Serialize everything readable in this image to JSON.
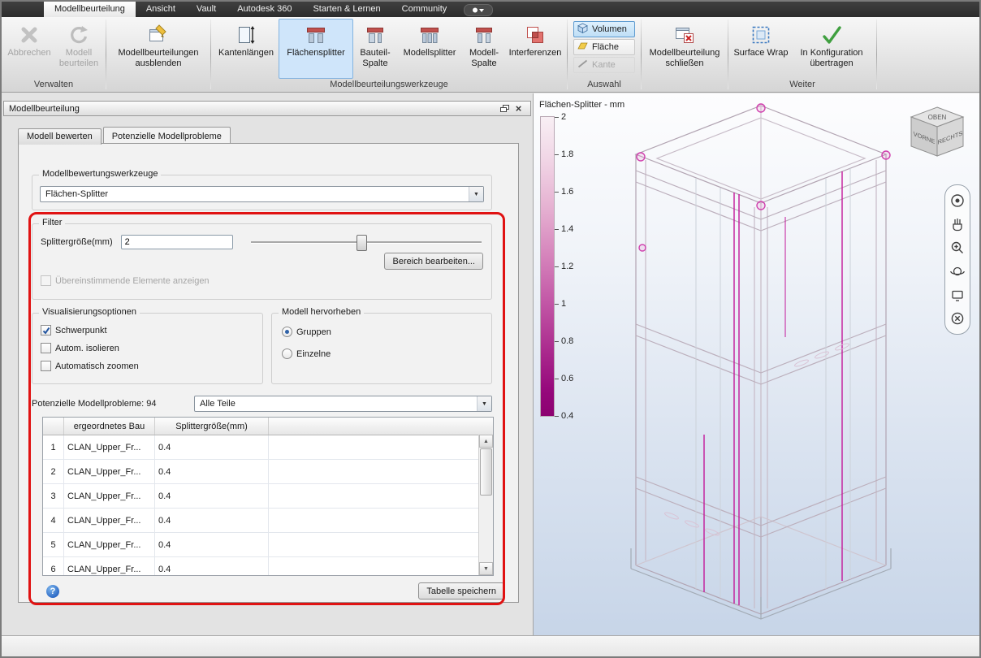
{
  "colors": {
    "selection_blue": "#cfe5fa",
    "splitter_magenta": "#c2189a",
    "annotation_red": "#e01212"
  },
  "menu": {
    "tabs": [
      "Modellbeurteilung",
      "Ansicht",
      "Vault",
      "Autodesk 360",
      "Starten & Lernen",
      "Community"
    ]
  },
  "ribbon": {
    "groups": {
      "verwalten": {
        "label": "Verwalten"
      },
      "werkzeuge": {
        "label": "Modellbeurteilungswerkzeuge"
      },
      "auswahl": {
        "label": "Auswahl"
      },
      "weiter": {
        "label": "Weiter"
      }
    },
    "buttons": {
      "abbrechen": "Abbrechen",
      "beurteilen": "Modell\nbeurteilen",
      "ausblenden": "Modellbeurteilungen\nausblenden",
      "kantenlaengen": "Kantenlängen",
      "flaechensplitter": "Flächensplitter",
      "bauteil_spalte": "Bauteil-\nSpalte",
      "modellsplitter": "Modellsplitter",
      "modell_spalte": "Modell-\nSpalte",
      "interferenzen": "Interferenzen",
      "volumen": "Volumen",
      "flaeche": "Fläche",
      "kante": "Kante",
      "schliessen": "Modellbeurteilung\nschließen",
      "surface_wrap": "Surface Wrap",
      "uebertragen": "In Konfiguration\nübertragen"
    }
  },
  "panel": {
    "title": "Modellbeurteilung",
    "tabs": [
      "Modell bewerten",
      "Potenzielle Modellprobleme"
    ],
    "tools_group": "Modellbewertungswerkzeuge",
    "tools_combo": "Flächen-Splitter",
    "filter": {
      "legend": "Filter",
      "size_label": "Splittergröße(mm)",
      "size_value": "2",
      "edit_range_button": "Bereich bearbeiten...",
      "show_matching": "Übereinstimmende Elemente anzeigen"
    },
    "visual": {
      "legend": "Visualisierungsoptionen",
      "opt1": "Schwerpunkt",
      "opt2": "Autom. isolieren",
      "opt3": "Automatisch zoomen"
    },
    "highlight": {
      "legend": "Modell hervorheben",
      "opt1": "Gruppen",
      "opt2": "Einzelne"
    },
    "problems_label": "Potenzielle Modellprobleme: 94",
    "parts_combo": "Alle Teile",
    "table": {
      "col_part": "ergeordnetes Bau",
      "col_size": "Splittergröße(mm)",
      "rows": [
        {
          "num": "1",
          "part": "CLAN_Upper_Fr...",
          "size": "0.4"
        },
        {
          "num": "2",
          "part": "CLAN_Upper_Fr...",
          "size": "0.4"
        },
        {
          "num": "3",
          "part": "CLAN_Upper_Fr...",
          "size": "0.4"
        },
        {
          "num": "4",
          "part": "CLAN_Upper_Fr...",
          "size": "0.4"
        },
        {
          "num": "5",
          "part": "CLAN_Upper_Fr...",
          "size": "0.4"
        },
        {
          "num": "6",
          "part": "CLAN_Upper_Fr...",
          "size": "0.4"
        }
      ]
    },
    "save_button": "Tabelle speichern"
  },
  "viewport": {
    "scale": {
      "title": "Flächen-Splitter - mm",
      "ticks": [
        "2",
        "1.8",
        "1.6",
        "1.4",
        "1.2",
        "1",
        "0.8",
        "0.6",
        "0.4"
      ]
    },
    "viewcube": {
      "top": "OBEN",
      "front": "VORNE",
      "right": "RECHTS"
    }
  },
  "icons": {
    "panel_close": "×",
    "combo_arrow": "▼",
    "scroll_up": "▲",
    "scroll_down": "▼",
    "help": "?"
  }
}
